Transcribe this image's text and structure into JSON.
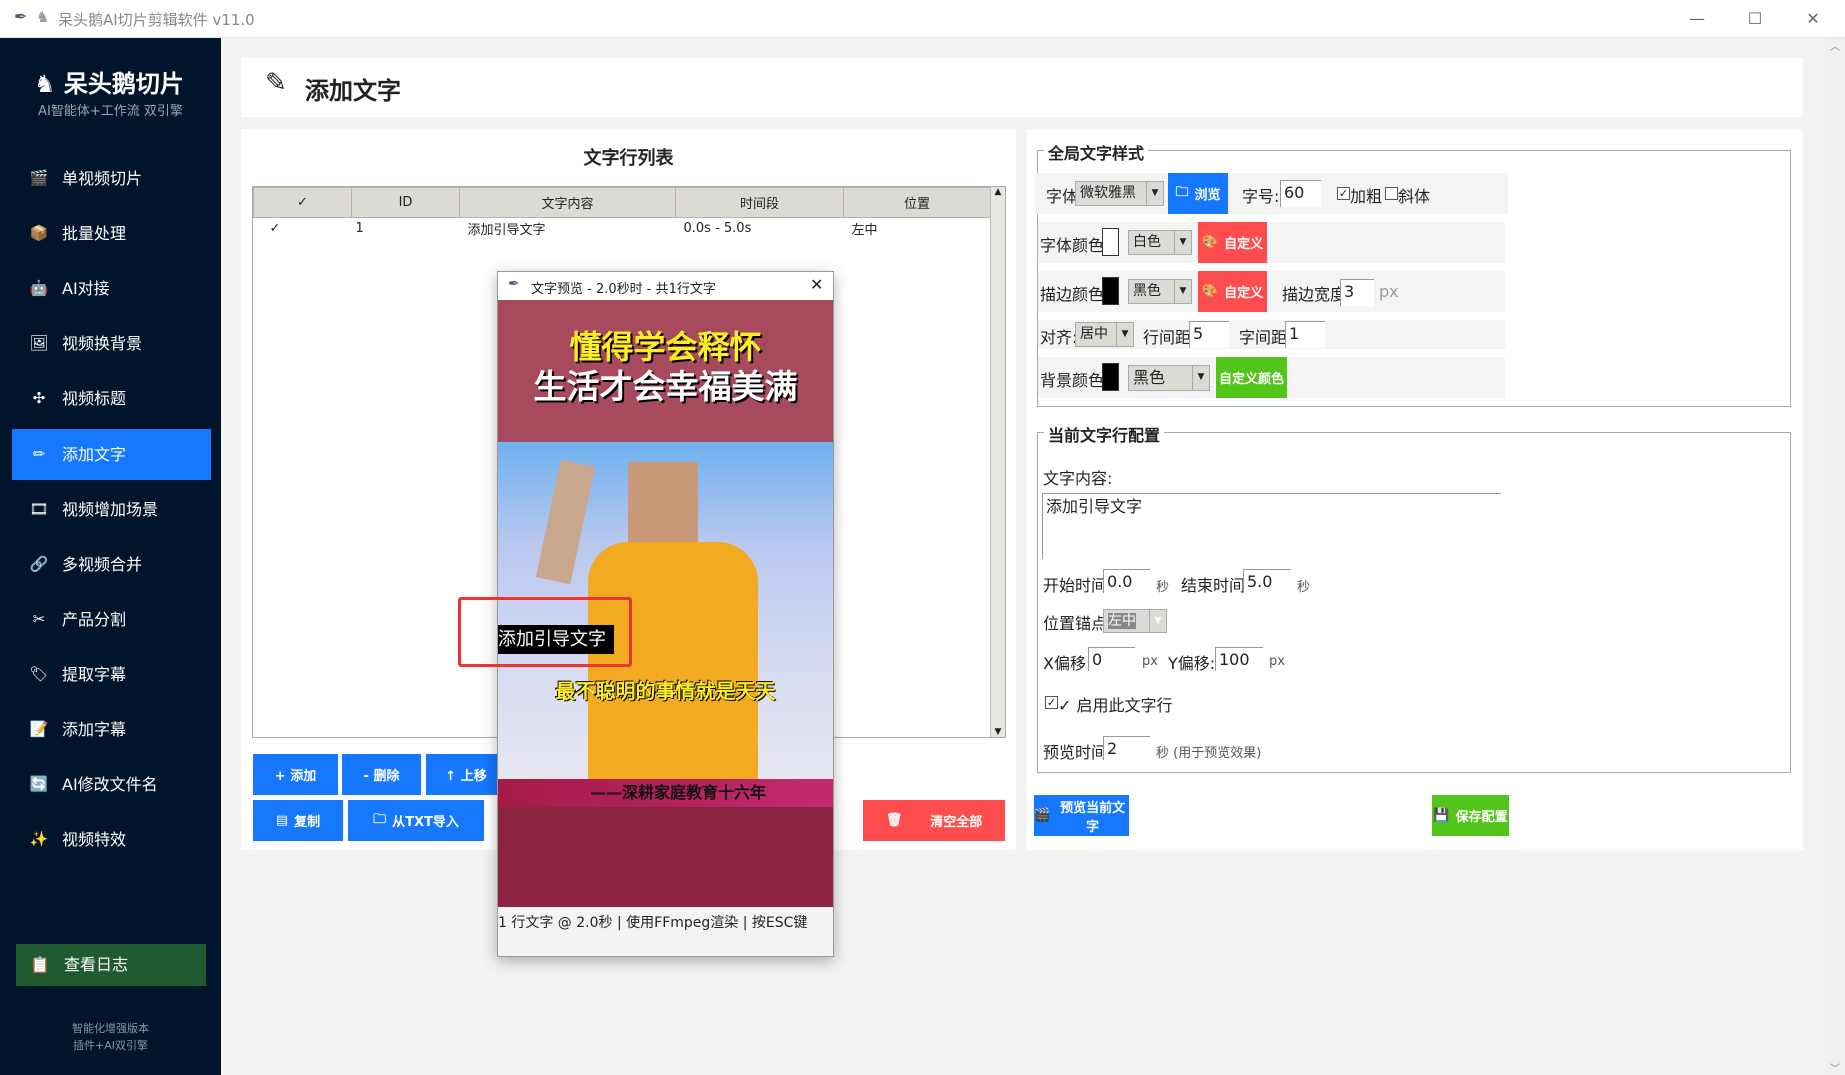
{
  "window": {
    "title": "呆头鹅AI切片剪辑软件 v11.0"
  },
  "sidebar": {
    "brand": "呆头鹅切片",
    "tagline": "AI智能体+工作流 双引擎",
    "items": [
      {
        "label": "单视频切片",
        "icon": "clapper-icon"
      },
      {
        "label": "批量处理",
        "icon": "box-icon"
      },
      {
        "label": "AI对接",
        "icon": "robot-icon"
      },
      {
        "label": "视频换背景",
        "icon": "picture-icon"
      },
      {
        "label": "视频标题",
        "icon": "puzzle-icon"
      },
      {
        "label": "添加文字",
        "icon": "pencil-icon"
      },
      {
        "label": "视频增加场景",
        "icon": "film-icon"
      },
      {
        "label": "多视频合并",
        "icon": "link-icon"
      },
      {
        "label": "产品分割",
        "icon": "scissors-icon"
      },
      {
        "label": "提取字幕",
        "icon": "tag-icon"
      },
      {
        "label": "添加字幕",
        "icon": "note-icon"
      },
      {
        "label": "AI修改文件名",
        "icon": "refresh-icon"
      },
      {
        "label": "视频特效",
        "icon": "sparkle-icon"
      }
    ],
    "active": "添加文字",
    "log_button": "查看日志",
    "footer1": "智能化增强版本",
    "footer2": "插件+AI双引擎"
  },
  "header": {
    "title": "添加文字"
  },
  "list": {
    "title": "文字行列表",
    "columns": [
      "✓",
      "ID",
      "文字内容",
      "时间段",
      "位置"
    ],
    "rows": [
      {
        "check": "✓",
        "id": "1",
        "text": "添加引导文字",
        "time": "0.0s - 5.0s",
        "pos": "左中"
      }
    ],
    "buttons": {
      "add": "+ 添加",
      "delete": "- 删除",
      "up": "↑ 上移",
      "copy": "复制",
      "import": "从TXT导入",
      "clear": "清空全部"
    }
  },
  "preview": {
    "title": "文字预览 - 2.0秒时 - 共1行文字",
    "headline1": "懂得学会释怀",
    "headline2": "生活才会幸福美满",
    "overlay": "添加引导文字",
    "subtitle": "最不聪明的事情就是天天",
    "banner": "——深耕家庭教育十六年",
    "status": "1 行文字 @ 2.0秒 | 使用FFmpeg渲染 | 按ESC键"
  },
  "global_style": {
    "legend": "全局文字样式",
    "font_label": "字体:",
    "font": "微软雅黑",
    "browse": "浏览",
    "size_label": "字号:",
    "size": "60",
    "bold": "加粗",
    "bold_checked": true,
    "italic": "斜体",
    "italic_checked": false,
    "font_color_label": "字体颜色:",
    "font_color": "白色",
    "font_color_hex": "#ffffff",
    "custom": "自定义",
    "stroke_color_label": "描边颜色:",
    "stroke_color": "黑色",
    "stroke_color_hex": "#000000",
    "stroke_width_label": "描边宽度:",
    "stroke_width": "3",
    "px": "px",
    "align_label": "对齐:",
    "align": "居中",
    "line_spacing_label": "行间距:",
    "line_spacing": "5",
    "char_spacing_label": "字间距:",
    "char_spacing": "1",
    "bg_color_label": "背景颜色:",
    "bg_color": "黑色",
    "bg_color_hex": "#000000",
    "custom_color": "自定义颜色"
  },
  "line_config": {
    "legend": "当前文字行配置",
    "content_label": "文字内容:",
    "content": "添加引导文字",
    "start_label": "开始时间:",
    "start": "0.0",
    "end_label": "结束时间:",
    "end": "5.0",
    "sec": "秒",
    "anchor_label": "位置锚点:",
    "anchor": "左中",
    "x_label": "X偏移:",
    "x": "0",
    "y_label": "Y偏移:",
    "y": "100",
    "px": "px",
    "enable": "✓ 启用此文字行",
    "enabled": true,
    "preview_time_label": "预览时间:",
    "preview_time": "2",
    "preview_hint": "秒 (用于预览效果)",
    "preview_button": "预览当前文字",
    "save_button": "保存配置"
  },
  "colors": {
    "sidebar": "#00152b",
    "accent": "#1677ff",
    "danger": "#ff4d4f",
    "success": "#52c41a"
  }
}
